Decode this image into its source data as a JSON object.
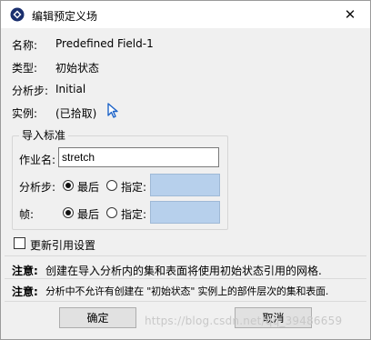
{
  "window": {
    "title": "编辑预定义场",
    "close_symbol": "✕"
  },
  "info": {
    "name_label": "名称:",
    "name_value": "Predefined Field-1",
    "type_label": "类型:",
    "type_value": "初始状态",
    "step_label": "分析步:",
    "step_value": "Initial",
    "instance_label": "实例:",
    "instance_value": "(已拾取)"
  },
  "import_criteria": {
    "title": "导入标准",
    "job_label": "作业名:",
    "job_value": "stretch",
    "step_label": "分析步:",
    "frame_label": "帧:",
    "last_label": "最后",
    "specify_label": "指定:"
  },
  "update_refs": {
    "label": "更新引用设置",
    "checked": false
  },
  "notes": [
    {
      "label": "注意:",
      "text": "创建在导入分析内的集和表面将使用初始状态引用的网格."
    },
    {
      "label": "注意:",
      "text": "分析中不允许有创建在 \"初始状态\" 实例上的部件层次的集和表面."
    }
  ],
  "buttons": {
    "ok": "确定",
    "cancel": "取消"
  },
  "watermark": "https://blog.csdn.net/qq_39486659",
  "colors": {
    "input_highlight": "#b7d0ec",
    "cursor": "#1e64c8"
  }
}
